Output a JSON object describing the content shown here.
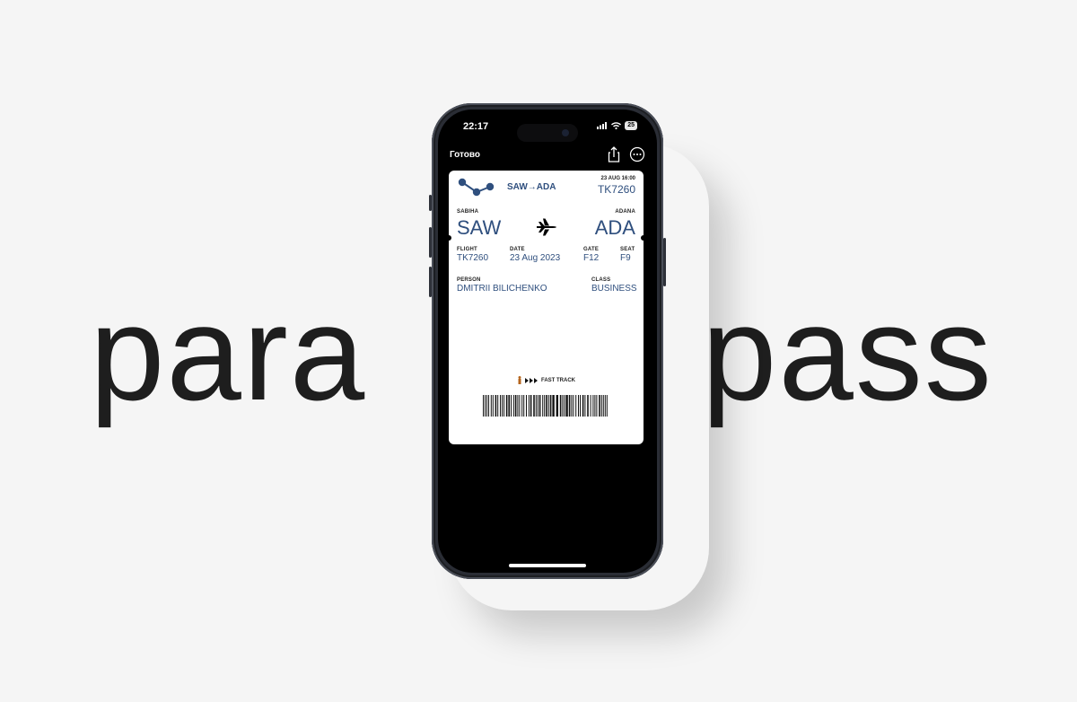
{
  "headline": {
    "left_word": "para",
    "right_word": "pass"
  },
  "status_bar": {
    "time": "22:17",
    "battery": "25"
  },
  "nav": {
    "done_label": "Готово"
  },
  "pass": {
    "route_short": "SAW→ADA",
    "header_date": "23 AUG 16:00",
    "header_flight": "TK7260",
    "origin_label": "SABIHA",
    "origin_code": "SAW",
    "destination_label": "ADANA",
    "destination_code": "ADA",
    "fields": {
      "flight_label": "FLIGHT",
      "flight_value": "TK7260",
      "date_label": "DATE",
      "date_value": "23 Aug 2023",
      "gate_label": "GATE",
      "gate_value": "F12",
      "seat_label": "SEAT",
      "seat_value": "F9",
      "person_label": "PERSON",
      "person_value": "DMITRII BILICHENKO",
      "class_label": "CLASS",
      "class_value": "BUSINESS"
    },
    "fast_track": "FAST TRACK",
    "accent_color": "#2f4f7e"
  },
  "icons": [
    "logo-dots-icon",
    "share-icon",
    "more-icon",
    "airplane-icon",
    "fast-track-icon",
    "signal-icon",
    "wifi-icon",
    "battery-icon"
  ]
}
